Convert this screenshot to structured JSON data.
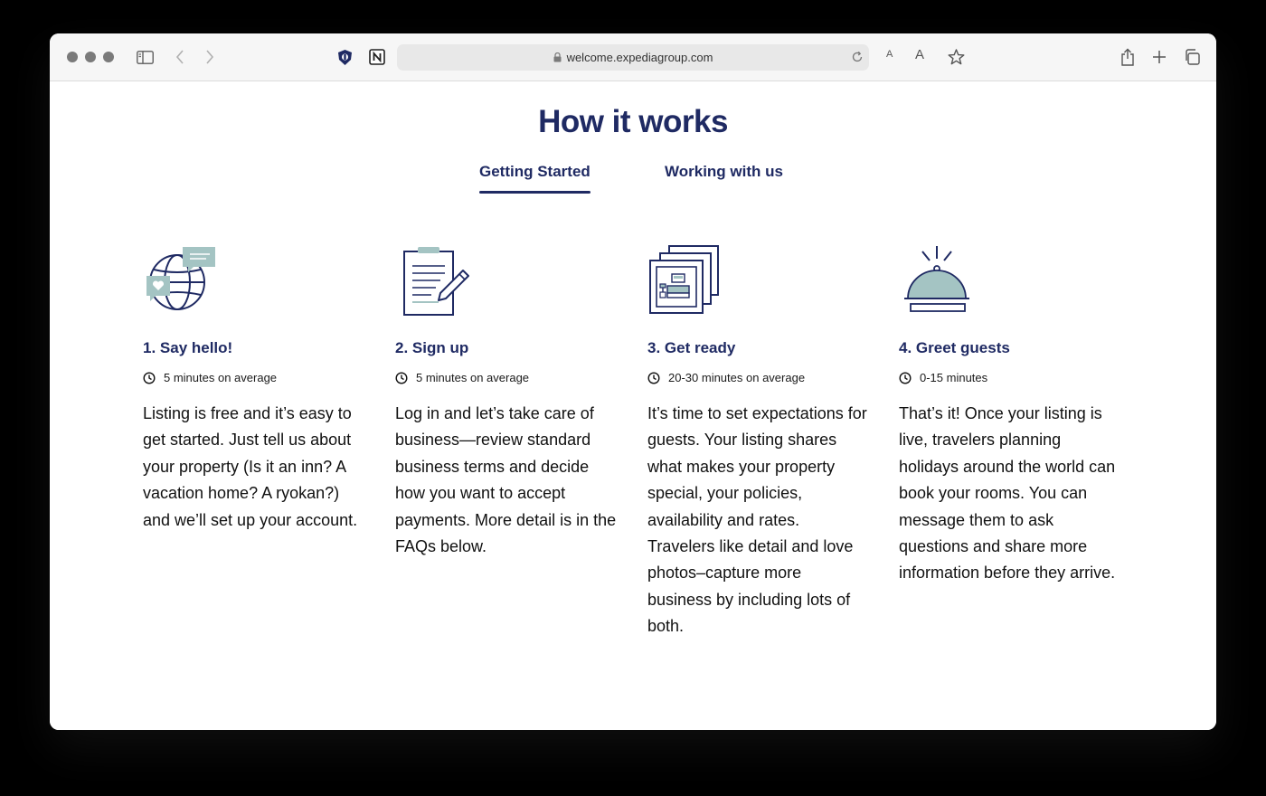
{
  "browser": {
    "url": "welcome.expediagroup.com",
    "font_small_label": "A",
    "font_large_label": "A"
  },
  "page": {
    "title": "How it works",
    "tabs": [
      {
        "label": "Getting Started",
        "active": true
      },
      {
        "label": "Working with us",
        "active": false
      }
    ],
    "accent_color": "#1f2a63",
    "icon_fill_color": "#a4c4c3",
    "steps": [
      {
        "icon": "globe-chat-icon",
        "title": "1. Say hello!",
        "time": "5 minutes on average",
        "description": "Listing is free and it’s easy to get started. Just tell us about your property (Is it an inn? A vacation home? A ryokan?) and we’ll set up your account."
      },
      {
        "icon": "clipboard-icon",
        "title": "2. Sign up",
        "time": "5 minutes on average",
        "description": "Log in and let’s take care of business—review standard business terms and decide how you want to accept payments. More detail is in the FAQs below."
      },
      {
        "icon": "photos-icon",
        "title": "3. Get ready",
        "time": "20-30 minutes on average",
        "description": "It’s time to set expectations for guests. Your listing shares what makes your property special, your policies, availability and rates. Travelers like detail and love photos–capture more business by including lots of both."
      },
      {
        "icon": "service-bell-icon",
        "title": "4. Greet guests",
        "time": "0-15 minutes",
        "description": "That’s it! Once your listing is live, travelers planning holidays around the world can book your rooms. You can message them to ask questions and share more information before they arrive."
      }
    ]
  }
}
